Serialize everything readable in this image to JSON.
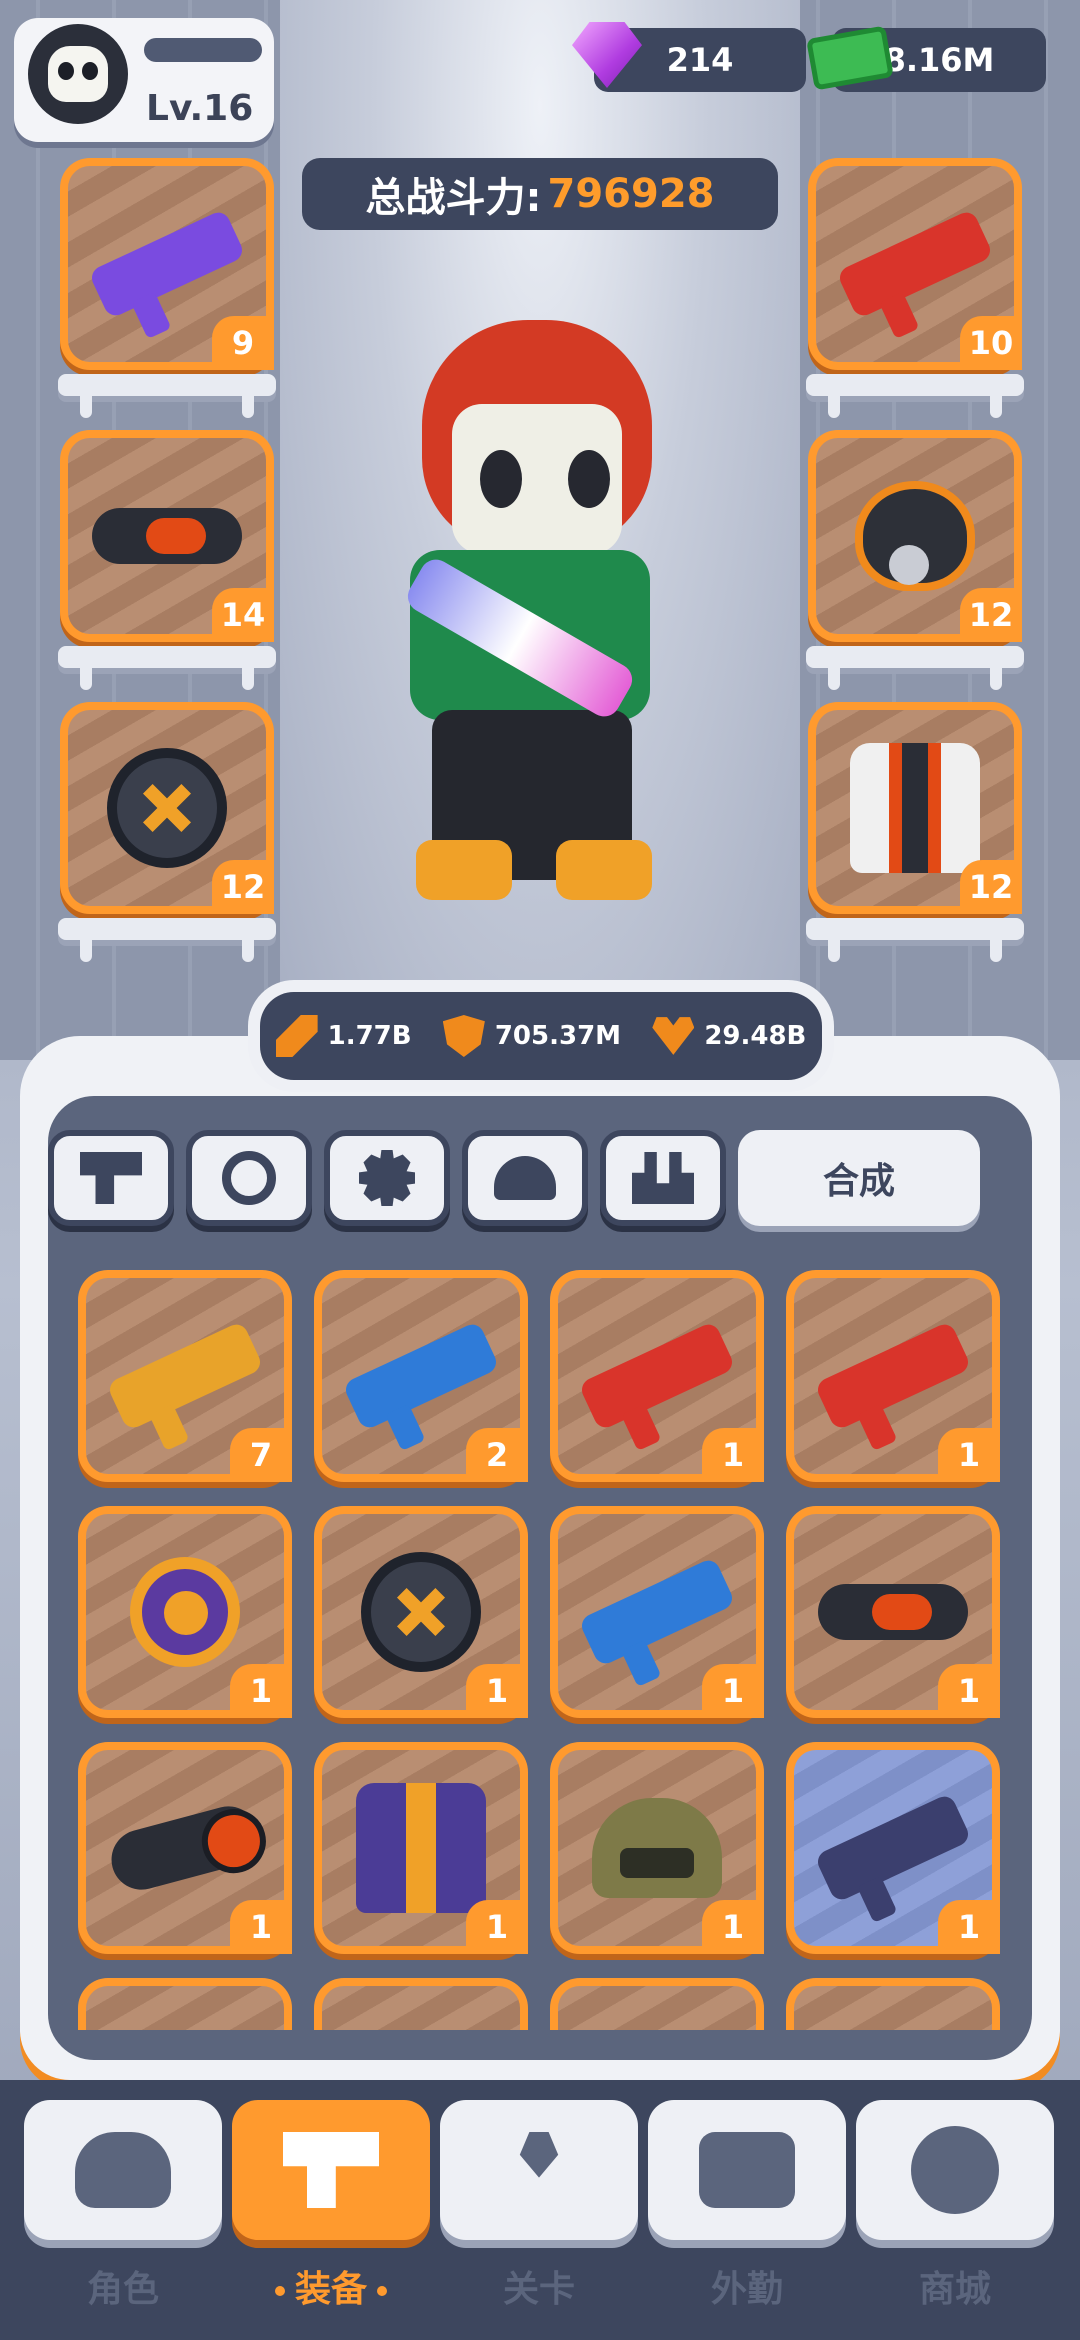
{
  "player": {
    "level": "Lv.16"
  },
  "currencies": {
    "gems": "214",
    "cash": "8.16M"
  },
  "power": {
    "label": "总战斗力:",
    "value": "796928"
  },
  "equipped": {
    "left": [
      {
        "icon": "rifle-icon",
        "count": "9"
      },
      {
        "icon": "goggles-icon",
        "count": "14"
      },
      {
        "icon": "ammo-drum-icon",
        "count": "12"
      }
    ],
    "right": [
      {
        "icon": "shotgun-icon",
        "count": "10"
      },
      {
        "icon": "gas-mask-icon",
        "count": "12"
      },
      {
        "icon": "jacket-icon",
        "count": "12"
      }
    ]
  },
  "stats": {
    "attack": "1.77B",
    "defense": "705.37M",
    "health": "29.48B"
  },
  "tabs": {
    "merge_label": "合成"
  },
  "inventory": [
    {
      "icon": "golden-rifle-icon",
      "count": "7"
    },
    {
      "icon": "blue-blaster-icon",
      "count": "2"
    },
    {
      "icon": "shotgun-icon",
      "count": "1"
    },
    {
      "icon": "shotgun-icon",
      "count": "1"
    },
    {
      "icon": "watch-icon",
      "count": "1"
    },
    {
      "icon": "ammo-drum-icon",
      "count": "1"
    },
    {
      "icon": "blue-blaster-icon",
      "count": "1"
    },
    {
      "icon": "goggles-icon",
      "count": "1"
    },
    {
      "icon": "scope-icon",
      "count": "1"
    },
    {
      "icon": "vest-icon",
      "count": "1"
    },
    {
      "icon": "helmet-icon",
      "count": "1"
    },
    {
      "icon": "sniper-rifle-icon",
      "count": "1"
    }
  ],
  "nav": {
    "role": "角色",
    "equipment": "装备",
    "level": "关卡",
    "expedition": "外勤",
    "shop": "商城"
  },
  "colors": {
    "accent": "#ff9a2e",
    "panel": "#3d465e",
    "stat_icon": "#f08a1c"
  }
}
